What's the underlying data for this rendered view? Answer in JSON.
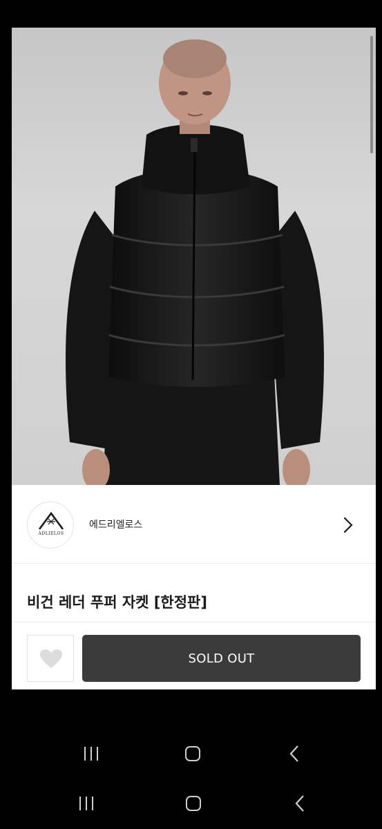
{
  "brand": {
    "name": "에드리엘로스",
    "logo_text": "ADLIELOS"
  },
  "product": {
    "title": "비건 레더 푸퍼 자켓 [한정판]"
  },
  "actions": {
    "like_icon": "heart-icon",
    "sold_out_label": "SOLD OUT"
  },
  "system_nav": {
    "items": [
      "recent-apps-icon",
      "home-icon",
      "back-icon"
    ]
  },
  "colors": {
    "sold_out_bg": "#3b3b3b",
    "heart": "#dcdcdc",
    "screen_bg": "#000000"
  }
}
